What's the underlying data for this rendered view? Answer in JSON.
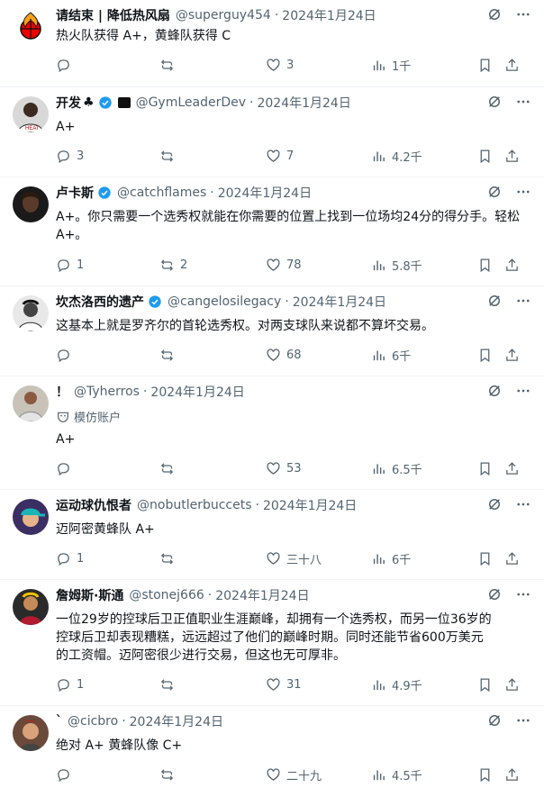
{
  "tweets": [
    {
      "name": "请结束 | 降低热风扇",
      "handle": "@superguy454",
      "date": "2024年1月24日",
      "text": "热火队获得 A+，黄蜂队获得 C",
      "reply_count": "",
      "retweet_count": "",
      "like_count": "3",
      "view_count": "1千",
      "avatar": "heat-logo"
    },
    {
      "name": "开发",
      "name_suffix": "♣",
      "handle": "@GymLeaderDev",
      "date": "2024年1月24日",
      "text": "A+",
      "reply_count": "3",
      "retweet_count": "",
      "like_count": "7",
      "view_count": "4.2千",
      "avatar": "player-photo"
    },
    {
      "name": "卢卡斯",
      "handle": "@catchflames",
      "date": "2024年1月24日",
      "text": "A+。你只需要一个选秀权就能在你需要的位置上找到一位场均24分的得分手。轻松A+。",
      "reply_count": "1",
      "retweet_count": "2",
      "like_count": "78",
      "view_count": "5.8千",
      "avatar": "dark-portrait"
    },
    {
      "name": "坎杰洛西的遗产",
      "handle": "@cangelosilegacy",
      "date": "2024年1月24日",
      "text": "这基本上就是罗齐尔的首轮选秀权。对两支球队来说都不算坏交易。",
      "reply_count": "",
      "retweet_count": "",
      "like_count": "68",
      "view_count": "6千",
      "avatar": "bw-portrait"
    },
    {
      "name": "！",
      "handle": "@Tyherros",
      "date": "2024年1月24日",
      "impostor_label": "模仿账户",
      "text": "A+",
      "reply_count": "",
      "retweet_count": "",
      "like_count": "53",
      "view_count": "6.5千",
      "avatar": "player-jersey"
    },
    {
      "name": "运动球仇恨者",
      "handle": "@nobutlerbuccets",
      "date": "2024年1月24日",
      "text": "迈阿密黄蜂队 A+",
      "reply_count": "1",
      "retweet_count": "",
      "like_count": "三十八",
      "view_count": "6千",
      "avatar": "teal-cap"
    },
    {
      "name": "詹姆斯·斯通",
      "handle": "@stonej666",
      "date": "2024年1月24日",
      "text_lines": [
        "一位29岁的控球后卫正值职业生涯巅峰，却拥有一个选秀权，而另一位36岁的",
        "控球后卫却表现糟糕，远远超过了他们的巅峰时期。同时还能节省600万美元",
        "的工资帽。迈阿密很少进行交易，但这也无可厚非。"
      ],
      "reply_count": "1",
      "retweet_count": "",
      "like_count": "31",
      "view_count": "4.9千",
      "avatar": "cartoon-player"
    },
    {
      "name": "`",
      "handle": "@cicbro",
      "date": "2024年1月24日",
      "text": "绝对 A+ 黄蜂队像 C+",
      "reply_count": "",
      "retweet_count": "",
      "like_count": "二十九",
      "view_count": "4.5千",
      "avatar": "red-portrait"
    }
  ],
  "dot": "·",
  "colors": {
    "text": "#0f1419",
    "muted": "#536471",
    "verified": "#1d9bf0",
    "divider": "#eff3f4"
  }
}
